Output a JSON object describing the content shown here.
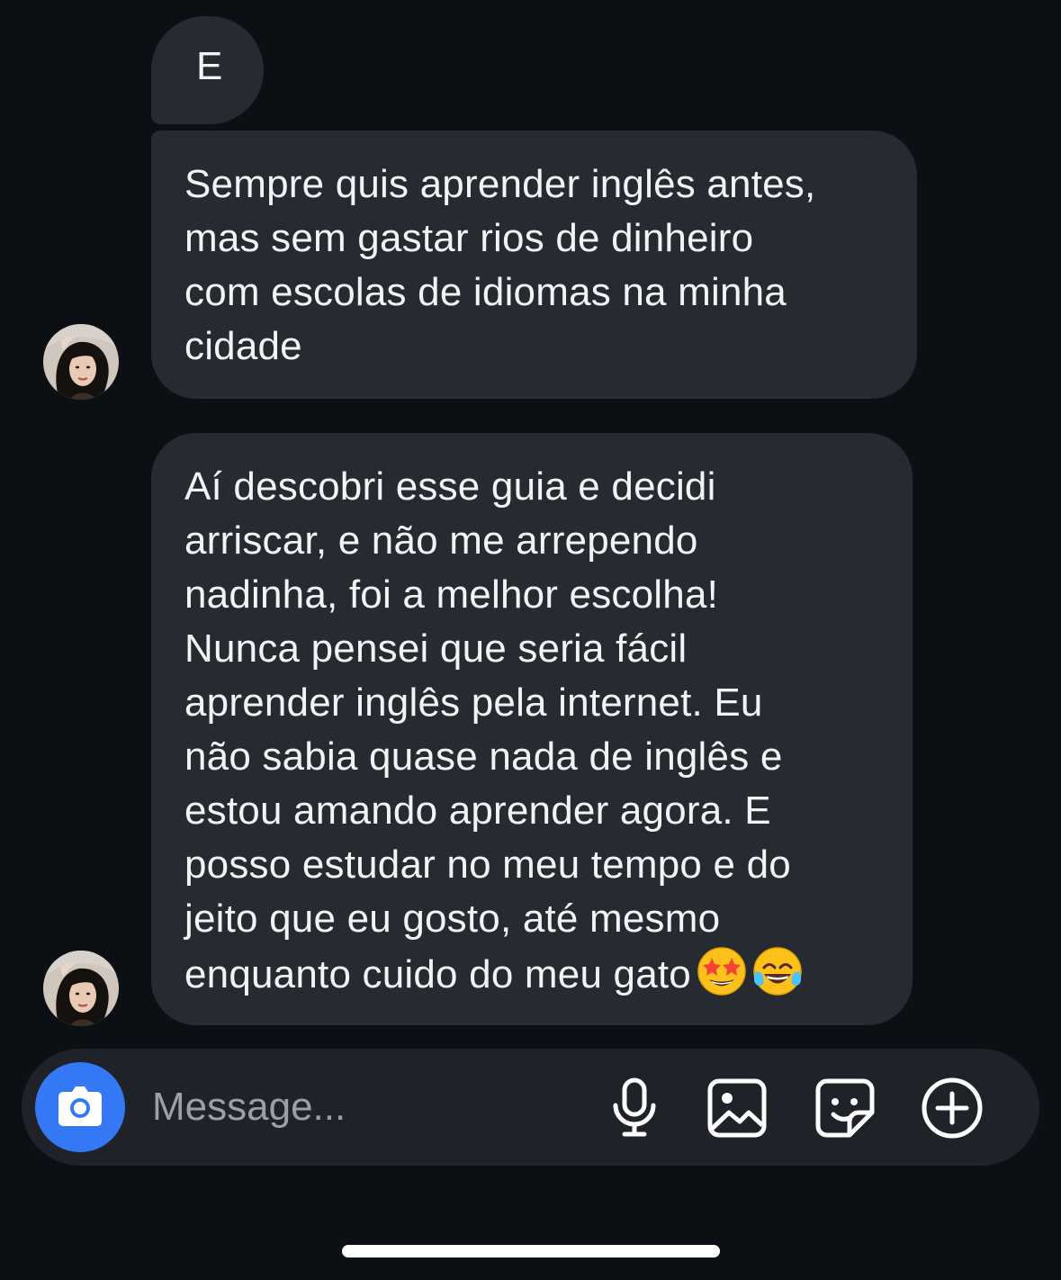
{
  "messages": [
    {
      "text": "E"
    },
    {
      "text": "Sempre quis aprender inglês antes,\nmas sem gastar rios de dinheiro\ncom escolas de idiomas na minha\ncidade"
    },
    {
      "text": "Aí descobri esse guia e decidi\narriscar, e não me arrependo\nnadinha, foi a melhor escolha!\nNunca pensei que seria fácil\naprender inglês pela internet. Eu\nnão sabia quase nada de inglês e\nestou amando aprender agora. E\nposso estudar no meu tempo e do\njeito que eu gosto, até mesmo\nenquanto cuido do meu gato",
      "emojis": [
        "star-struck-emoji",
        "tears-of-joy-emoji"
      ]
    }
  ],
  "composer": {
    "placeholder": "Message...",
    "icons": [
      "camera-icon",
      "microphone-icon",
      "gallery-icon",
      "sticker-icon",
      "plus-icon"
    ],
    "camera_color": "#3478f6"
  },
  "colors": {
    "background": "#0c0f14",
    "bubble": "#262a31",
    "composer": "#1f2228"
  }
}
